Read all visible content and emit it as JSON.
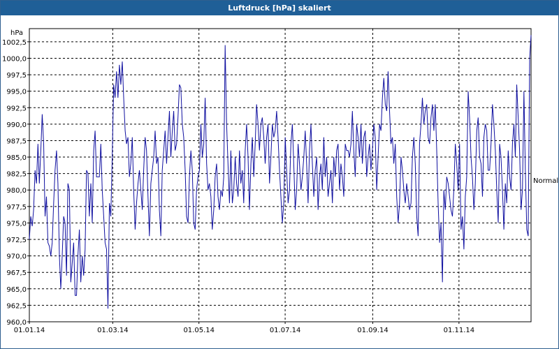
{
  "window": {
    "title": "Luftdruck [hPa] skaliert"
  },
  "chart_data": {
    "type": "line",
    "title": "Luftdruck [hPa] skaliert",
    "unit_label": "hPa",
    "reference_label": "Normal",
    "reference_value": 981.5,
    "ylim": [
      960.0,
      1004.5
    ],
    "yticks": [
      "960,0",
      "962,5",
      "965,0",
      "967,5",
      "970,0",
      "972,5",
      "975,0",
      "977,5",
      "980,0",
      "982,5",
      "985,0",
      "987,5",
      "990,0",
      "992,5",
      "995,0",
      "997,5",
      "1000,0",
      "1002,5"
    ],
    "xlim": [
      0,
      355
    ],
    "xticks": [
      {
        "label": "01.01.14",
        "day": 0
      },
      {
        "label": "01.03.14",
        "day": 59
      },
      {
        "label": "01.05.14",
        "day": 120
      },
      {
        "label": "01.07.14",
        "day": 181
      },
      {
        "label": "01.09.14",
        "day": 243
      },
      {
        "label": "01.11.14",
        "day": 304
      }
    ],
    "grid": true,
    "colors": {
      "line": "#1010a0",
      "grid": "#000000",
      "title_bar": "#1f5f97"
    },
    "series": [
      {
        "values": [
          972.5,
          976,
          974.5,
          977,
          983,
          981,
          987,
          981,
          986,
          991.5,
          987,
          976,
          979,
          972,
          971.5,
          970,
          972,
          978,
          983,
          986,
          981,
          970,
          965,
          970,
          976,
          975,
          967,
          981,
          980,
          966,
          969,
          972,
          964,
          964,
          970,
          974,
          966,
          970,
          967,
          971,
          983,
          982.5,
          976,
          981,
          975,
          986,
          989,
          982,
          982,
          982,
          987,
          980,
          976,
          972,
          971,
          962,
          978,
          976,
          985,
          996,
          994,
          998,
          994,
          999,
          996,
          999.5,
          994,
          989,
          987,
          988,
          982,
          984,
          988,
          980,
          974,
          978,
          981,
          983,
          980,
          977,
          983,
          988,
          986,
          979,
          973,
          981,
          983,
          985,
          989,
          984,
          985,
          977,
          973,
          983,
          986,
          989,
          984,
          988,
          992,
          985,
          989,
          992,
          986,
          987,
          991,
          996,
          995.5,
          990,
          988,
          983,
          976,
          975,
          982,
          986,
          983,
          975,
          974,
          980,
          982,
          983,
          990,
          985,
          987,
          994,
          984,
          980,
          981,
          979,
          974,
          977,
          982,
          984,
          979,
          977,
          980,
          979,
          982,
          1002,
          990,
          984,
          978,
          986,
          978,
          980,
          985,
          981,
          979,
          986,
          981,
          983,
          978,
          986,
          990,
          985,
          977,
          984,
          988,
          982,
          987,
          993,
          990,
          986,
          990,
          991,
          988,
          984,
          988,
          990,
          981,
          985,
          990,
          988,
          989,
          992,
          988,
          983,
          979,
          975,
          978,
          988,
          983,
          978,
          980,
          987,
          990,
          984,
          977,
          980,
          987,
          984,
          980,
          982,
          985,
          989,
          984,
          978,
          986,
          990,
          984,
          979,
          983,
          985,
          977,
          982,
          984,
          980,
          988,
          982,
          985,
          979,
          981,
          983,
          978,
          985,
          982,
          986,
          987,
          980,
          984,
          982,
          979,
          987,
          986,
          986,
          985,
          987,
          992,
          986,
          982,
          990,
          988,
          985,
          990,
          984,
          988,
          989,
          982,
          985,
          987,
          983,
          986,
          990,
          988,
          980,
          985,
          990,
          989,
          994,
          997,
          993,
          992,
          998,
          992,
          987,
          988,
          984,
          987,
          979,
          975,
          978,
          985,
          983,
          980,
          978,
          981,
          979,
          977,
          978,
          985,
          988,
          984,
          976,
          973,
          987,
          990,
          994,
          990,
          992,
          993,
          988,
          987,
          991,
          993,
          989,
          993,
          986,
          978,
          972,
          975,
          966,
          980,
          977,
          982,
          981,
          979,
          977,
          976,
          980,
          987,
          984,
          980,
          987,
          974,
          976,
          971,
          979,
          982,
          995,
          991,
          985,
          982,
          977,
          981,
          989,
          991,
          985,
          984,
          979,
          988,
          990,
          989,
          983,
          983,
          987,
          993,
          990,
          986,
          980,
          975,
          987,
          985,
          980,
          974,
          981,
          978,
          986,
          982,
          980,
          987,
          990,
          985,
          996,
          991,
          986,
          977,
          980,
          995,
          983,
          974,
          973,
          1000,
          1003.5
        ]
      }
    ]
  }
}
